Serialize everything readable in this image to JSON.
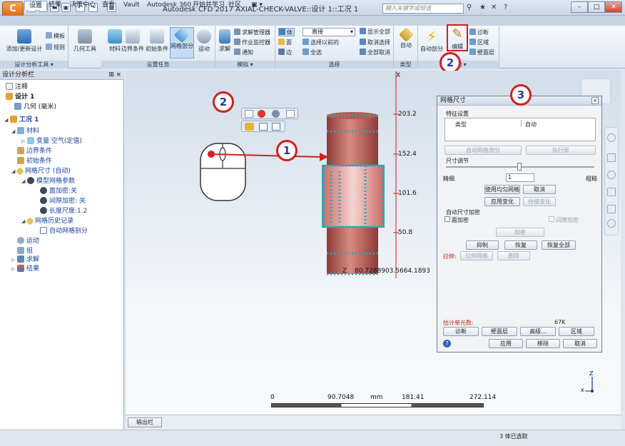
{
  "window": {
    "title": "Autodesk CFD 2017   AXIAL-CHECK-VALVE::设计 1::工况 1",
    "search_placeholder": "键入关键字或短语",
    "app_button": "C"
  },
  "quick_access": [
    "▤",
    "▭",
    "▬",
    "▣",
    "↶",
    "↷",
    "▦"
  ],
  "tabs": [
    "设置",
    "结果",
    "决策中心",
    "查看",
    "Vault",
    "Autodesk 360",
    "开始并学习",
    "社区",
    "▣ ▾"
  ],
  "ribbon": {
    "groups": {
      "design_study_tools": "设计分析工具 ▾",
      "setup_tasks": "设置任务",
      "solve": "模拟 ▾",
      "selection": "选择",
      "type": "类型",
      "tools": "自动 ▾"
    },
    "add_update_design": "添加/更新设计",
    "template": "模板",
    "rules": "规则",
    "geometry_tools": "几何工具",
    "materials": "材料",
    "boundary_conditions": "边界条件",
    "initial_conditions": "初始条件",
    "mesh": "网格剖分",
    "motion": "运动",
    "solve": "求解",
    "solve_manager": "求解管理器",
    "job_monitor": "作业监控器",
    "notify": "通知",
    "sel_volume": "体",
    "sel_face": "面",
    "sel_edge": "边",
    "sel_mode_value": "直接",
    "select_previous": "选择以前的",
    "select_all": "全选",
    "show_all": "显示全部",
    "deselect": "取消选择",
    "deselect_all": "全部取消",
    "auto": "自动",
    "auto_size": "自动剖分",
    "edit": "编辑",
    "diagnostics": "诊断",
    "regions": "区域",
    "gap_refinement": "壁面层"
  },
  "left_panel": {
    "title": "设计分析栏",
    "items": [
      {
        "label": "注释",
        "level": 0
      },
      {
        "label": "设计 1",
        "level": 0
      },
      {
        "label": "几何 (毫米)",
        "level": 1
      },
      {
        "label": "工况 1",
        "level": 0
      },
      {
        "label": "材料",
        "level": 1
      },
      {
        "label": "变量 空气(定值)",
        "level": 2
      },
      {
        "label": "边界条件",
        "level": 1
      },
      {
        "label": "初始条件",
        "level": 1
      },
      {
        "label": "网格尺寸 (自动)",
        "level": 1
      },
      {
        "label": "模型网格参数",
        "level": 2
      },
      {
        "label": "面加密:关",
        "level": 3
      },
      {
        "label": "间隙加密: 关",
        "level": 3
      },
      {
        "label": "长度尺度:1.2",
        "level": 3
      },
      {
        "label": "网格历史记录",
        "level": 2
      },
      {
        "label": "自动网格剖分",
        "level": 3
      },
      {
        "label": "运动",
        "level": 1
      },
      {
        "label": "组",
        "level": 1
      },
      {
        "label": "求解",
        "level": 1
      },
      {
        "label": "结果",
        "level": 1
      }
    ]
  },
  "viewport": {
    "axis_x_label": "X",
    "axis_z_label": "Z",
    "ruler_ticks": [
      "203.2",
      "152.4",
      "101.6",
      "50.8"
    ],
    "z_readout": "80.7288903.5664.1893",
    "scale": {
      "labels": [
        "0",
        "90.7048",
        "mm",
        "181.41",
        "272.114"
      ]
    },
    "triad": {
      "z": "Z",
      "x": "x"
    },
    "callouts": [
      "1",
      "2",
      "2",
      "3"
    ]
  },
  "dialog": {
    "title": "网格尺寸",
    "feature_settings": "特征设置",
    "col_type": "类型",
    "col_auto": "自动",
    "auto_size_btn": "自动网格剖分",
    "spread_btn": "执行宏",
    "size_adjust": "尺寸调节",
    "coarse": "精细",
    "fine": "粗糙",
    "size_value": "1",
    "use_uniform_btn": "使用均匀网格",
    "cancel_btn": "取消",
    "apply_changes_btn": "应用变化",
    "pending_changes_btn": "待储变化",
    "auto_refine_label": "自动尺寸加密",
    "surface_refine_label": "面加密",
    "gap_refine_label": "间隙加密",
    "refine_btn": "加密",
    "suppress_btn": "抑制",
    "restore_btn": "恢复",
    "restore_all_btn": "恢复全部",
    "stretch_label": "拉伸:",
    "stretch_btn": "拉伸网格",
    "delete_btn": "删除",
    "estimated_label": "估计单元数:",
    "estimated_value": "67K",
    "diagnostics_btn": "诊断",
    "wall_layer_btn": "壁面层",
    "advanced_btn": "高级...",
    "regions_btn": "区域",
    "apply_btn": "应用",
    "reset_btn": "移除",
    "cancel2_btn": "取消",
    "help_icon": "?"
  },
  "bottom": {
    "output_tab": "输出栏",
    "status": "3 体已选取"
  },
  "colors": {
    "callout_border": "#d21f1f",
    "cylinder": "#c96a66",
    "mesh_points": "#2aa8b4",
    "ruler": "#d21f1f"
  }
}
